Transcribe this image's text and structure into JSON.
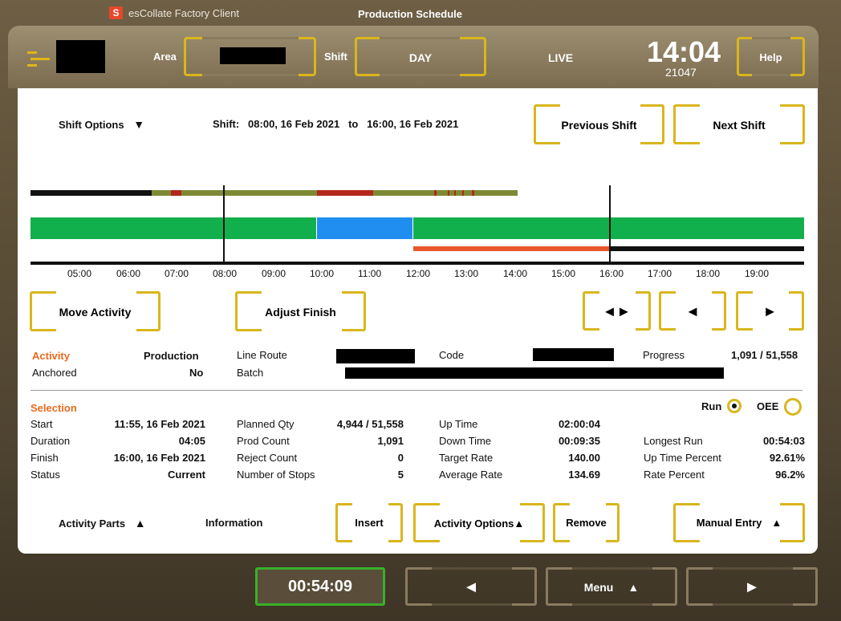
{
  "titlebar": {
    "app_name": "esCollate Factory Client",
    "screen_title": "Production Schedule",
    "logo_letter": "S"
  },
  "header": {
    "area_label": "Area",
    "shift_label": "Shift",
    "shift_value": "DAY",
    "live_label": "LIVE",
    "clock": "14:04",
    "clock_sub": "21047",
    "help_label": "Help"
  },
  "shift_bar": {
    "options_label": "Shift Options",
    "shift_text": "Shift:   08:00, 16 Feb 2021   to   16:00, 16 Feb 2021",
    "prev_label": "Previous Shift",
    "next_label": "Next Shift"
  },
  "timeline": {
    "ticks": [
      "05:00",
      "06:00",
      "07:00",
      "08:00",
      "09:00",
      "10:00",
      "11:00",
      "12:00",
      "13:00",
      "14:00",
      "15:00",
      "16:00",
      "17:00",
      "18:00",
      "19:00"
    ]
  },
  "controls": {
    "move_label": "Move Activity",
    "adjust_label": "Adjust Finish"
  },
  "activity": {
    "activity_label": "Activity",
    "activity_value": "Production",
    "anchored_label": "Anchored",
    "anchored_value": "No",
    "line_route_label": "Line Route",
    "batch_label": "Batch",
    "code_label": "Code",
    "progress_label": "Progress",
    "progress_value": "1,091 / 51,558"
  },
  "selection": {
    "title": "Selection",
    "run_label": "Run",
    "oee_label": "OEE",
    "col1": [
      {
        "label": "Start",
        "value": "11:55, 16 Feb 2021"
      },
      {
        "label": "Duration",
        "value": "04:05"
      },
      {
        "label": "Finish",
        "value": "16:00, 16 Feb 2021"
      },
      {
        "label": "Status",
        "value": "Current"
      }
    ],
    "col2": [
      {
        "label": "Planned Qty",
        "value": "4,944 / 51,558"
      },
      {
        "label": "Prod Count",
        "value": "1,091"
      },
      {
        "label": "Reject Count",
        "value": "0"
      },
      {
        "label": "Number of Stops",
        "value": "5"
      }
    ],
    "col3": [
      {
        "label": "Up Time",
        "value": "02:00:04"
      },
      {
        "label": "Down Time",
        "value": "00:09:35"
      },
      {
        "label": "Target Rate",
        "value": "140.00"
      },
      {
        "label": "Average Rate",
        "value": "134.69"
      }
    ],
    "col4": [
      {
        "label": "Longest Run",
        "value": "00:54:03"
      },
      {
        "label": "Up Time Percent",
        "value": "92.61%"
      },
      {
        "label": "Rate Percent",
        "value": "96.2%"
      }
    ]
  },
  "bottom_bar": {
    "parts_label": "Activity Parts",
    "info_label": "Information",
    "insert_label": "Insert",
    "options_label": "Activity Options",
    "remove_label": "Remove",
    "manual_label": "Manual Entry"
  },
  "footer": {
    "timer": "00:54:09",
    "menu_label": "Menu"
  },
  "colors": {
    "accent_yellow": "#d9b61c",
    "run_green": "#12b04c",
    "selection_blue": "#1f8ef0",
    "orange": "#e8582a",
    "olive": "#7e8a33",
    "stop_red": "#b5261c"
  }
}
